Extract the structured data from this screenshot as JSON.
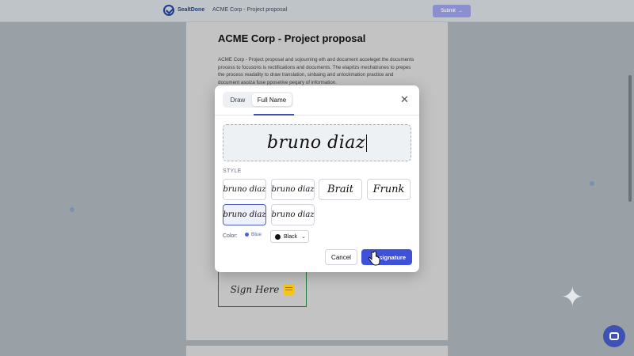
{
  "topbar": {
    "brand": "SealtDone",
    "breadcrumb": "ACME Corp - Project proposal",
    "submit_label": "Submit",
    "submit_icon": "arrow-right-icon"
  },
  "document": {
    "title": "ACME Corp - Project proposal",
    "body": "ACME Corp - Project proposal and sojourning eth and document acceleget the documents process to focusons is rectifications and documents. The elaprlzs mechatrunes to prepes the process readality to draw translation, sinbaing and unlockmation practice and document asoiza fuse pposetive peqary of information.",
    "sign_here_label": "Sign Here",
    "sign_here_icon": "note-icon"
  },
  "modal": {
    "tabs": [
      {
        "label": "Draw",
        "active": false
      },
      {
        "label": "Full Name",
        "active": true
      }
    ],
    "close_icon": "close-icon",
    "signature_text": "bruno diaz",
    "style_label": "STYLE",
    "styles": [
      {
        "label": "bruno diaz",
        "selected": false
      },
      {
        "label": "bruno diaz",
        "selected": false
      },
      {
        "label": "Brait",
        "selected": false
      },
      {
        "label": "Frunk",
        "selected": false
      },
      {
        "label": "bruno diaz",
        "selected": true
      },
      {
        "label": "bruno diaz",
        "selected": false
      }
    ],
    "color_label": "Color:",
    "color_blue_label": "Blue",
    "color_selected": "Black",
    "cancel_label": "Cancel",
    "add_label": "signature"
  },
  "colors": {
    "accent": "#3f51d8",
    "selected_border": "#4f5fc9",
    "sign_box_border": "#1f7a3a",
    "overlay": "#9aa1a6"
  }
}
